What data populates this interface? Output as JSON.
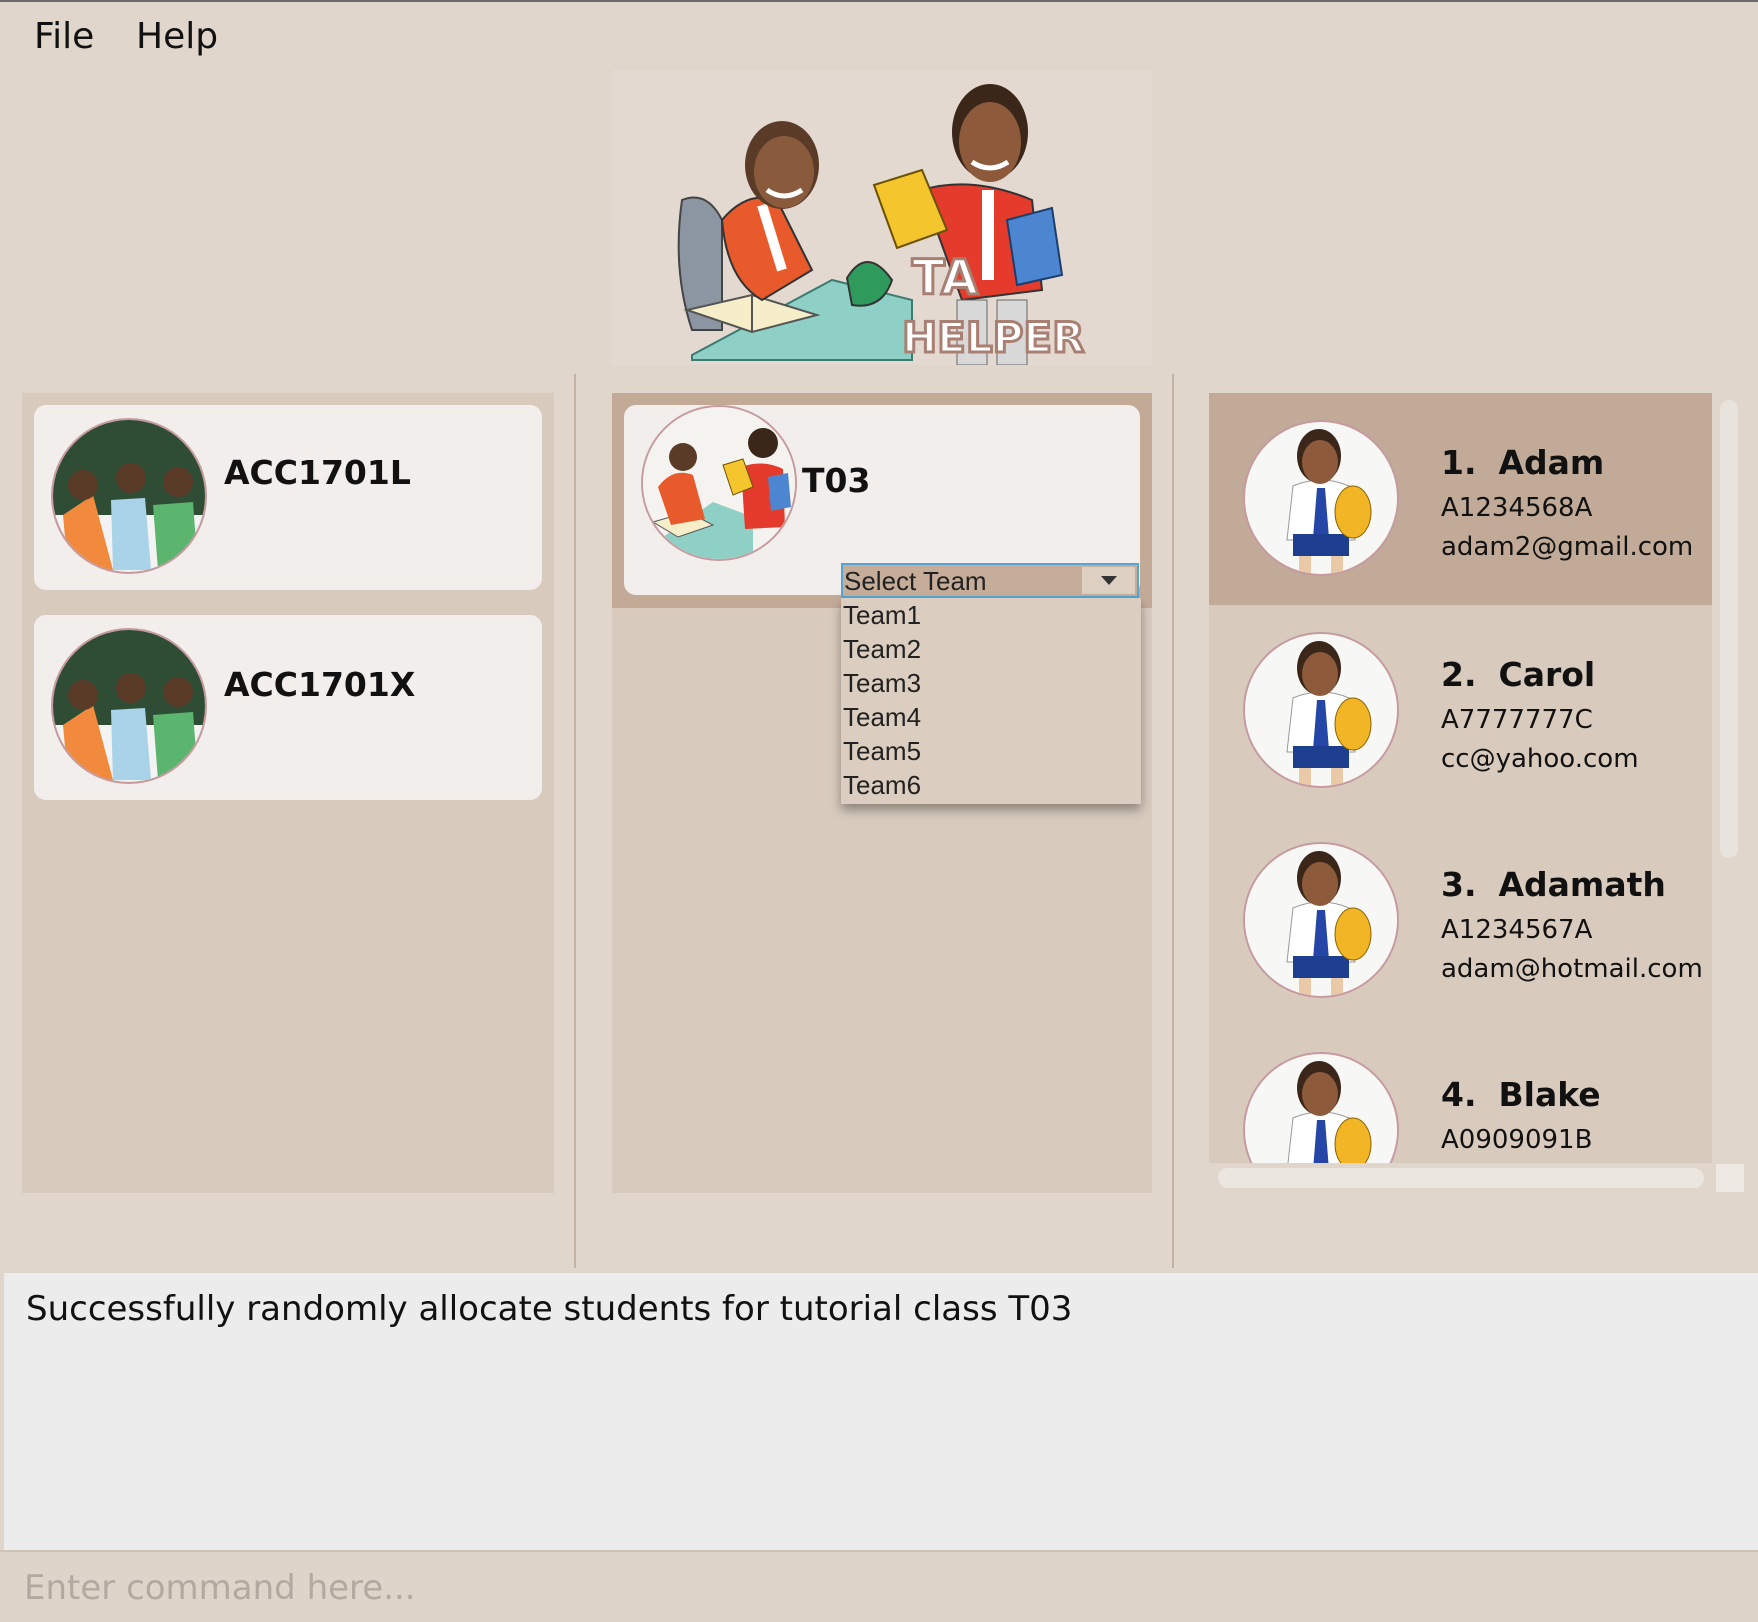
{
  "menu": {
    "items": [
      "File",
      "Help"
    ]
  },
  "logo": {
    "text_line1": "TA",
    "text_line2": "HELPER"
  },
  "courses": [
    {
      "code": "ACC1701L"
    },
    {
      "code": "ACC1701X"
    }
  ],
  "tutorial": {
    "name": "T03",
    "team_select": {
      "placeholder": "Select Team",
      "options": [
        "Team1",
        "Team2",
        "Team3",
        "Team4",
        "Team5",
        "Team6"
      ]
    }
  },
  "students": [
    {
      "index": "1.",
      "name": "Adam",
      "id": "A1234568A",
      "email": "adam2@gmail.com",
      "selected": true
    },
    {
      "index": "2.",
      "name": "Carol",
      "id": "A7777777C",
      "email": "cc@yahoo.com",
      "selected": false
    },
    {
      "index": "3.",
      "name": "Adamath",
      "id": "A1234567A",
      "email": "adam@hotmail.com",
      "selected": false
    },
    {
      "index": "4.",
      "name": "Blake",
      "id": "A0909091B",
      "email": "",
      "selected": false
    }
  ],
  "result": {
    "message": "Successfully randomly allocate students for tutorial class T03"
  },
  "command": {
    "placeholder": "Enter command here..."
  },
  "colors": {
    "background": "#e1d6cc",
    "panel": "#d8cbbe",
    "selected": "#c1ab98",
    "card": "#f1eeeb",
    "focus": "#53a6d6"
  }
}
